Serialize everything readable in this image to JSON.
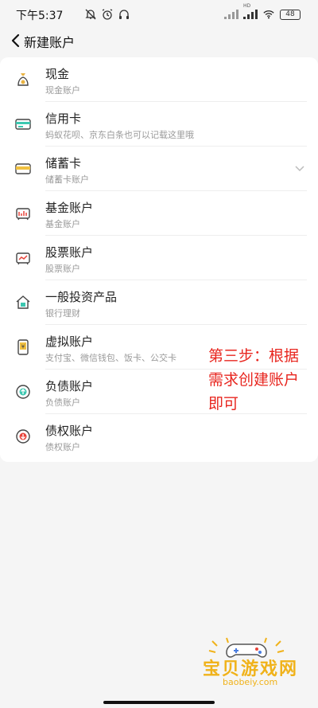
{
  "status_bar": {
    "time": "下午5:37",
    "battery": "48",
    "hd_label": "HD"
  },
  "nav": {
    "title": "新建账户"
  },
  "accounts": [
    {
      "title": "现金",
      "subtitle": "现金账户",
      "icon": "money-bag-icon"
    },
    {
      "title": "信用卡",
      "subtitle": "蚂蚁花呗、京东白条也可以记载这里哦",
      "icon": "credit-card-icon"
    },
    {
      "title": "储蓄卡",
      "subtitle": "储蓄卡账户",
      "icon": "debit-card-icon",
      "expandable": true
    },
    {
      "title": "基金账户",
      "subtitle": "基金账户",
      "icon": "fund-chart-icon"
    },
    {
      "title": "股票账户",
      "subtitle": "股票账户",
      "icon": "stock-chart-icon"
    },
    {
      "title": "一般投资产品",
      "subtitle": "银行理财",
      "icon": "bank-icon"
    },
    {
      "title": "虚拟账户",
      "subtitle": "支付宝、微信钱包、饭卡、公交卡",
      "icon": "phone-wallet-icon"
    },
    {
      "title": "负债账户",
      "subtitle": "负债账户",
      "icon": "liability-icon"
    },
    {
      "title": "债权账户",
      "subtitle": "债权账户",
      "icon": "claim-icon"
    }
  ],
  "annotation": {
    "text": "第三步：根据需求创建账户即可",
    "color": "#e8261f"
  },
  "watermark": {
    "text": "宝贝游戏网",
    "url": "baobeiy.com",
    "color": "#f0b21a"
  }
}
